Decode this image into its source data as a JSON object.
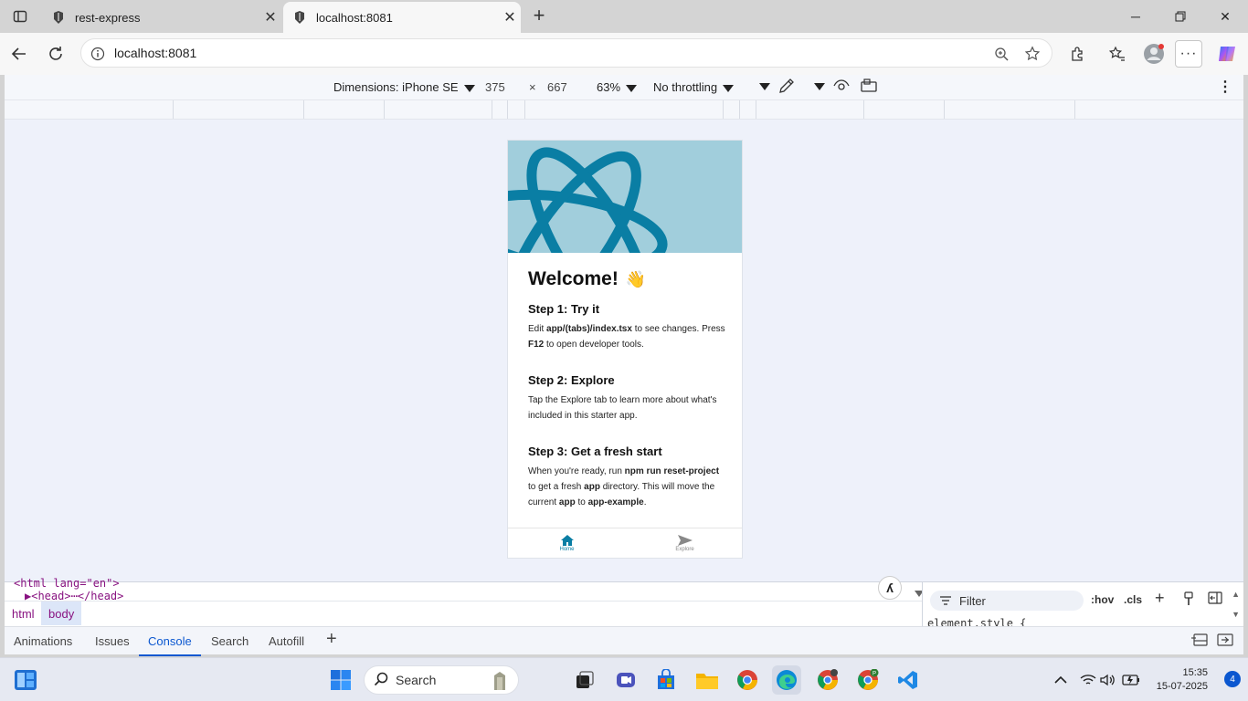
{
  "browser": {
    "tabs": [
      {
        "title": "rest-express",
        "active": false
      },
      {
        "title": "localhost:8081",
        "active": true
      }
    ],
    "url": "localhost:8081"
  },
  "device_toolbar": {
    "dimensions_label": "Dimensions: iPhone SE",
    "width": "375",
    "times": "×",
    "height": "667",
    "zoom": "63%",
    "throttling": "No throttling"
  },
  "app": {
    "welcome": "Welcome!",
    "wave": "👋",
    "steps": [
      {
        "title": "Step 1: Try it"
      },
      {
        "title": "Step 2: Explore"
      },
      {
        "title": "Step 3: Get a fresh start"
      }
    ],
    "step1": {
      "t1": "Edit ",
      "b1": "app/(tabs)/index.tsx",
      "t2": " to see changes. Press ",
      "b2": "F12",
      "t3": " to open developer tools."
    },
    "step2": {
      "text": "Tap the Explore tab to learn more about what's included in this starter app."
    },
    "step3": {
      "t1": "When you're ready, run ",
      "b1": "npm run reset-project",
      "t2": " to get a fresh ",
      "b2": "app",
      "t3": " directory. This will move the current ",
      "b3": "app",
      "t4": " to ",
      "b4": "app-example",
      "t5": "."
    },
    "bottom_tabs": [
      {
        "label": "Home"
      },
      {
        "label": "Explore"
      }
    ]
  },
  "devtools": {
    "dom_line1": "<html lang=\"en\">",
    "dom_line2": "▶<head>⋯</head>",
    "breadcrumbs": [
      "html",
      "body"
    ],
    "drawer_tabs": [
      "Animations",
      "Issues",
      "Console",
      "Search",
      "Autofill"
    ],
    "active_drawer_tab": "Console",
    "filter_placeholder": "Filter",
    "hov": ":hov",
    "cls": ".cls",
    "element_style": "element.style {"
  },
  "taskbar": {
    "search_label": "Search",
    "time": "15:35",
    "date": "15-07-2025",
    "notifications": "4"
  },
  "colors": {
    "accent": "#0a7ea4",
    "hero_bg": "#a1cedc"
  }
}
